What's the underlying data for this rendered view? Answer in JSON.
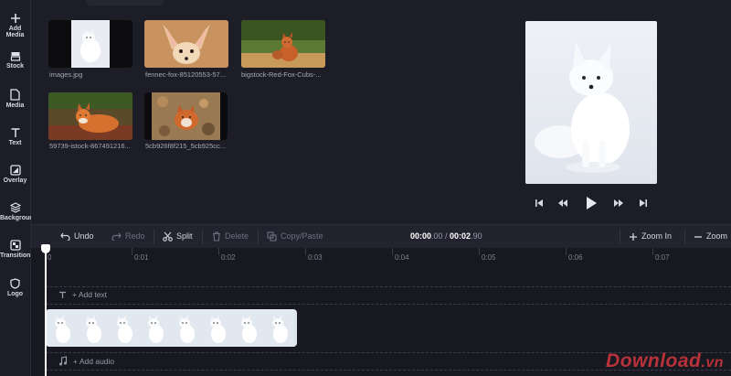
{
  "sidebar": {
    "items": [
      {
        "label": "Add Media",
        "icon": "plus-icon"
      },
      {
        "label": "Stock",
        "icon": "stock-icon"
      },
      {
        "label": "Media",
        "icon": "media-icon"
      },
      {
        "label": "Text",
        "icon": "text-icon"
      },
      {
        "label": "Overlay",
        "icon": "overlay-icon"
      },
      {
        "label": "Background",
        "icon": "layers-icon"
      },
      {
        "label": "Transition",
        "icon": "transition-icon"
      },
      {
        "label": "Logo",
        "icon": "shield-icon"
      }
    ]
  },
  "media": {
    "items": [
      {
        "caption": "images.jpg"
      },
      {
        "caption": "fennec-fox-85120553-57..."
      },
      {
        "caption": "bigstock-Red-Fox-Cubs-..."
      },
      {
        "caption": "59739-istock-867491216..."
      },
      {
        "caption": "5cb926f8f215_5cb925cc..."
      }
    ]
  },
  "toolbar": {
    "undo": "Undo",
    "redo": "Redo",
    "split": "Split",
    "delete": "Delete",
    "copy_paste": "Copy/Paste",
    "time_current": "00:00",
    "time_current_frac": ".00 / ",
    "time_total": "00:02",
    "time_total_frac": ".90",
    "zoom_in": "Zoom In",
    "zoom_out": "Zoom"
  },
  "timeline": {
    "ticks": [
      "0",
      "0:01",
      "0:02",
      "0:03",
      "0:04",
      "0:05",
      "0:06",
      "0:07"
    ],
    "add_text": "+ Add text",
    "add_audio": "+ Add audio"
  },
  "watermark": {
    "text": "Download",
    "suffix": ".vn"
  },
  "colors": {
    "background": "#1b1b24",
    "panel": "#232330",
    "accent": "#ffffff",
    "watermark": "#b8323a"
  }
}
